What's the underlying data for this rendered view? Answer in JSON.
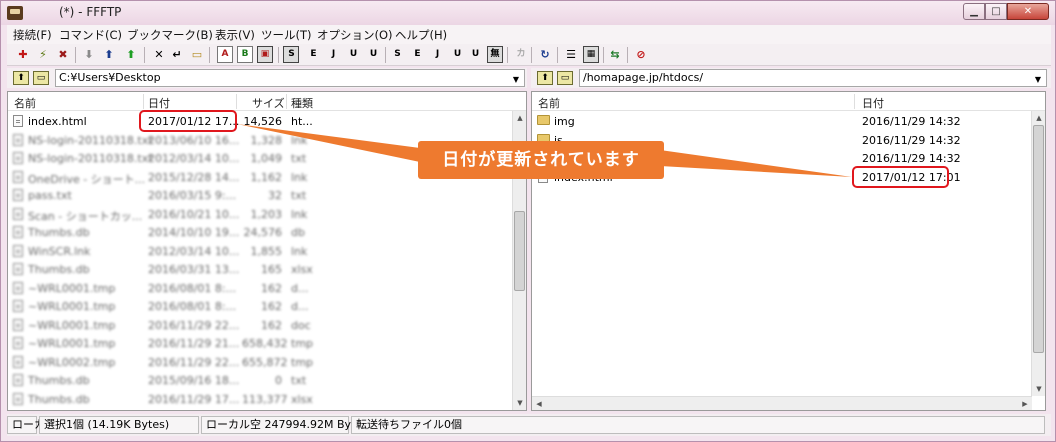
{
  "window": {
    "title": "(*) - FFFTP"
  },
  "menu": [
    "接続(F)",
    "コマンド(C)",
    "ブックマーク(B)",
    "表示(V)",
    "ツール(T)",
    "オプション(O)",
    "ヘルプ(H)"
  ],
  "toolbar": {
    "ascii_label": "A",
    "binary_label": "B",
    "sjis_label": "S",
    "euc_label": "E",
    "jis_label": "J",
    "utf8_label": "U",
    "kana_label": "カ",
    "none_label": "無"
  },
  "local": {
    "path": "C:¥Users¥Desktop",
    "columns": [
      "名前",
      "日付",
      "サイズ",
      "種類"
    ],
    "files": [
      {
        "name": "index.html",
        "date": "2017/01/12 17...",
        "size": "14,526",
        "type": "ht..."
      },
      {
        "name": "NS-login-20110318.txt",
        "date": "2013/06/10 16...",
        "size": "1,328",
        "type": "lnk"
      },
      {
        "name": "NS-login-20110318.txt",
        "date": "2012/03/14 10...",
        "size": "1,049",
        "type": "txt"
      },
      {
        "name": "OneDrive - ショート...",
        "date": "2015/12/28 14...",
        "size": "1,162",
        "type": "lnk"
      },
      {
        "name": "pass.txt",
        "date": "2016/03/15 9:...",
        "size": "32",
        "type": "txt"
      },
      {
        "name": "Scan - ショートカッ...",
        "date": "2016/10/21 10...",
        "size": "1,203",
        "type": "lnk"
      },
      {
        "name": "Thumbs.db",
        "date": "2014/10/10 19...",
        "size": "24,576",
        "type": "db"
      },
      {
        "name": "WinSCR.lnk",
        "date": "2012/03/14 10...",
        "size": "1,855",
        "type": "lnk"
      },
      {
        "name": "Thumbs.db",
        "date": "2016/03/31 13...",
        "size": "165",
        "type": "xlsx"
      },
      {
        "name": "~WRL0001.tmp",
        "date": "2016/08/01 8:...",
        "size": "162",
        "type": "d..."
      },
      {
        "name": "~WRL0001.tmp",
        "date": "2016/08/01 8:...",
        "size": "162",
        "type": "d..."
      },
      {
        "name": "~WRL0001.tmp",
        "date": "2016/11/29 22...",
        "size": "162",
        "type": "doc"
      },
      {
        "name": "~WRL0001.tmp",
        "date": "2016/11/29 21...",
        "size": "658,432",
        "type": "tmp"
      },
      {
        "name": "~WRL0002.tmp",
        "date": "2016/11/29 22...",
        "size": "655,872",
        "type": "tmp"
      },
      {
        "name": "Thumbs.db",
        "date": "2015/09/16 18...",
        "size": "0",
        "type": "txt"
      },
      {
        "name": "Thumbs.db",
        "date": "2016/11/29 17...",
        "size": "113,377",
        "type": "xlsx"
      }
    ]
  },
  "remote": {
    "path": "/homapage.jp/htdocs/",
    "columns": [
      "名前",
      "日付"
    ],
    "files": [
      {
        "name": "img",
        "date": "2016/11/29 14:32",
        "folder": true
      },
      {
        "name": "js",
        "date": "2016/11/29 14:32",
        "folder": true
      },
      {
        "name": "",
        "date": "2016/11/29 14:32",
        "folder": true
      },
      {
        "name": "index.html",
        "date": "2017/01/12 17:01",
        "folder": false
      }
    ]
  },
  "status": {
    "location": "ローカル",
    "selection": "選択1個 (14.19K Bytes)",
    "free_space": "ローカル空 247994.92M Bytes",
    "queue": "転送待ちファイル0個"
  },
  "annotation": {
    "callout_text": "日付が更新されています"
  },
  "colors": {
    "callout": "#ee7a2f",
    "highlight": "#e0171d",
    "arrow": "#ee7a2f"
  }
}
